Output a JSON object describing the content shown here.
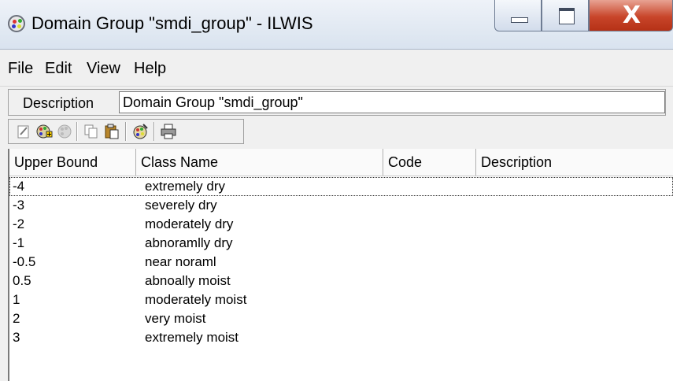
{
  "window": {
    "title": "Domain Group \"smdi_group\" - ILWIS",
    "close_glyph": "X"
  },
  "menu": [
    "File",
    "Edit",
    "View",
    "Help"
  ],
  "description": {
    "label": "Description",
    "value": "Domain Group \"smdi_group\""
  },
  "toolbar": {
    "buttons": [
      "edit-icon",
      "add-item-icon",
      "delete-item-icon",
      "copy-icon",
      "paste-icon",
      "representation-icon",
      "print-icon"
    ]
  },
  "table": {
    "headers": [
      "Upper Bound",
      "Class Name",
      "Code",
      "Description"
    ],
    "rows": [
      {
        "upper_bound": "-4",
        "class_name": "extremely dry",
        "code": "",
        "description": ""
      },
      {
        "upper_bound": "-3",
        "class_name": "severely dry",
        "code": "",
        "description": ""
      },
      {
        "upper_bound": "-2",
        "class_name": "moderately dry",
        "code": "",
        "description": ""
      },
      {
        "upper_bound": "-1",
        "class_name": "abnoramlly dry",
        "code": "",
        "description": ""
      },
      {
        "upper_bound": "-0.5",
        "class_name": "near noraml",
        "code": "",
        "description": ""
      },
      {
        "upper_bound": "0.5",
        "class_name": "abnoally moist",
        "code": "",
        "description": ""
      },
      {
        "upper_bound": "1",
        "class_name": "moderately moist",
        "code": "",
        "description": ""
      },
      {
        "upper_bound": "2",
        "class_name": "very moist",
        "code": "",
        "description": ""
      },
      {
        "upper_bound": "3",
        "class_name": "extremely moist",
        "code": "",
        "description": ""
      }
    ]
  },
  "colors": {
    "close_button": "#c8452a",
    "titlebar": "#dfe7f1"
  }
}
